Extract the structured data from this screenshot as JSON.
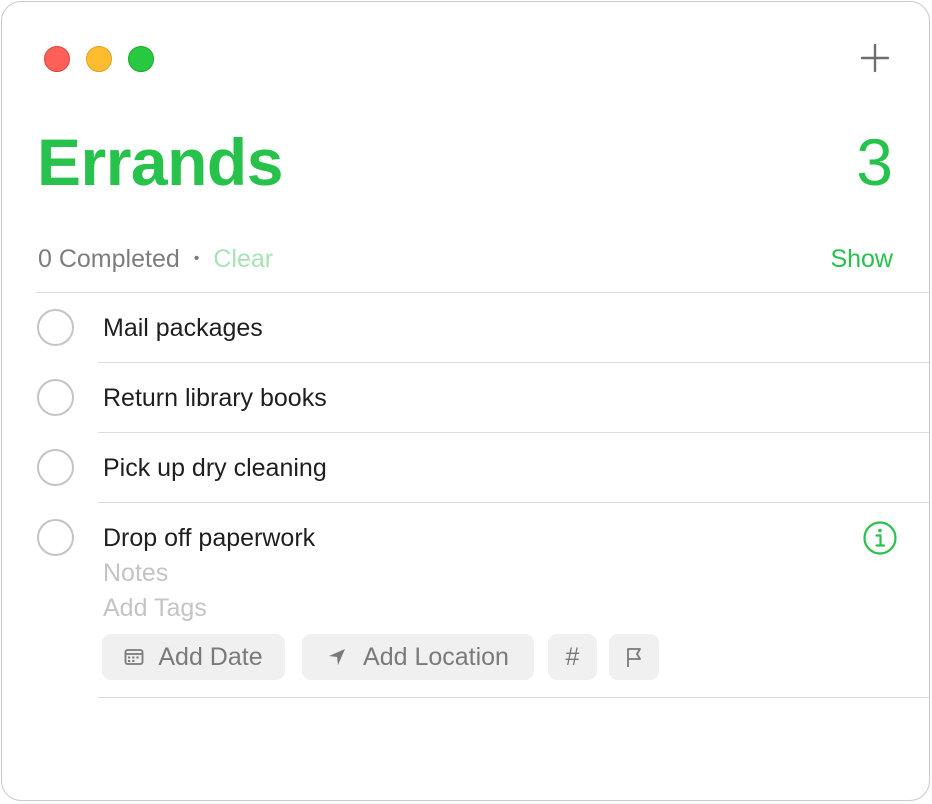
{
  "window": {
    "controls": [
      "close",
      "minimize",
      "zoom"
    ],
    "add_icon": "plus-icon"
  },
  "list": {
    "title": "Errands",
    "count": "3",
    "accent_color": "#27c24c"
  },
  "completed": {
    "text": "0 Completed",
    "separator": "•",
    "clear_label": "Clear",
    "show_label": "Show"
  },
  "tasks": [
    {
      "title": "Mail packages"
    },
    {
      "title": "Return library books"
    },
    {
      "title": "Pick up dry cleaning"
    },
    {
      "title": "Drop off paperwork",
      "notes_placeholder": "Notes",
      "tags_placeholder": "Add Tags",
      "info_icon": "info-icon",
      "actions": {
        "date_label": "Add Date",
        "date_icon": "calendar-icon",
        "location_label": "Add Location",
        "location_icon": "location-arrow-icon",
        "tag_symbol": "#",
        "flag_icon": "flag-icon"
      }
    }
  ]
}
